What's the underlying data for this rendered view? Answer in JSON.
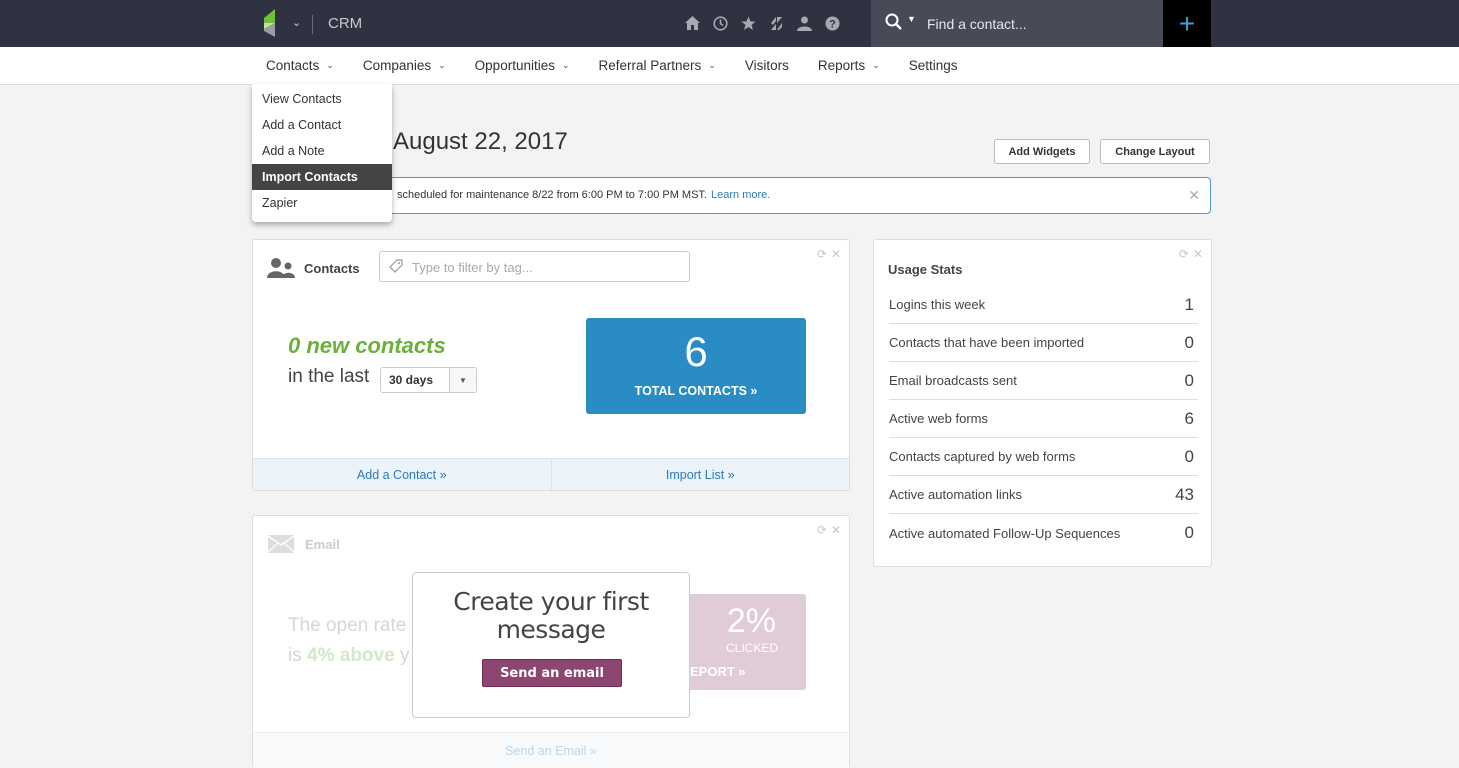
{
  "topbar": {
    "app_name": "CRM",
    "icons": [
      "home-icon",
      "clock-icon",
      "star-icon",
      "apps-icon",
      "user-icon",
      "help-icon"
    ],
    "search_placeholder": "Find a contact...",
    "quick_add_label": "+",
    "colors": {
      "background": "#2f3241",
      "search_bg": "#474a57",
      "plus_accent": "#3d9fd6"
    }
  },
  "nav": {
    "items": [
      {
        "label": "Contacts",
        "has_menu": true
      },
      {
        "label": "Companies",
        "has_menu": true
      },
      {
        "label": "Opportunities",
        "has_menu": true
      },
      {
        "label": "Referral Partners",
        "has_menu": true
      },
      {
        "label": "Visitors",
        "has_menu": false
      },
      {
        "label": "Reports",
        "has_menu": true
      },
      {
        "label": "Settings",
        "has_menu": false
      }
    ],
    "open_menu": {
      "parent": "Contacts",
      "items": [
        "View Contacts",
        "Add a Contact",
        "Add a Note",
        "Import Contacts",
        "Zapier"
      ],
      "highlighted": "Import Contacts"
    }
  },
  "header": {
    "date": "August 22, 2017",
    "add_widgets": "Add Widgets",
    "change_layout": "Change Layout"
  },
  "alert": {
    "text": "scheduled for maintenance 8/22 from 6:00 PM to 7:00 PM MST.",
    "link": "Learn more.",
    "close": "✕"
  },
  "contacts_widget": {
    "title": "Contacts",
    "tag_filter_placeholder": "Type to filter by tag...",
    "new_contacts": "0 new contacts",
    "in_the_last": "in the last",
    "period": "30 days",
    "total_count": "6",
    "total_label": "TOTAL CONTACTS »",
    "footer_links": [
      "Add a Contact »",
      "Import List »"
    ],
    "colors": {
      "new_contacts": "#6bb139",
      "total_box": "#2a8cc4",
      "link": "#2b7bb9"
    }
  },
  "usage_stats": {
    "title": "Usage Stats",
    "rows": [
      {
        "label": "Logins this week",
        "value": "1"
      },
      {
        "label": "Contacts that have been imported",
        "value": "0"
      },
      {
        "label": "Email broadcasts sent",
        "value": "0"
      },
      {
        "label": "Active web forms",
        "value": "6"
      },
      {
        "label": "Contacts captured by web forms",
        "value": "0"
      },
      {
        "label": "Active automation links",
        "value": "43"
      },
      {
        "label": "Active automated Follow-Up Sequences",
        "value": "0"
      }
    ]
  },
  "email_widget": {
    "title": "Email",
    "open_rate_line1": "The open rate",
    "open_rate_is": "is",
    "open_rate_highlight": "4% above",
    "open_rate_tail": "y",
    "clicked_value": "2%",
    "clicked_label": "CLICKED",
    "report_label": "EPORT »",
    "footer_link": "Send an Email »",
    "overlay": {
      "title": "Create your first message",
      "button": "Send an email",
      "button_color": "#8c466f"
    }
  },
  "widget_controls": {
    "refresh": "⟳",
    "close": "✕"
  }
}
